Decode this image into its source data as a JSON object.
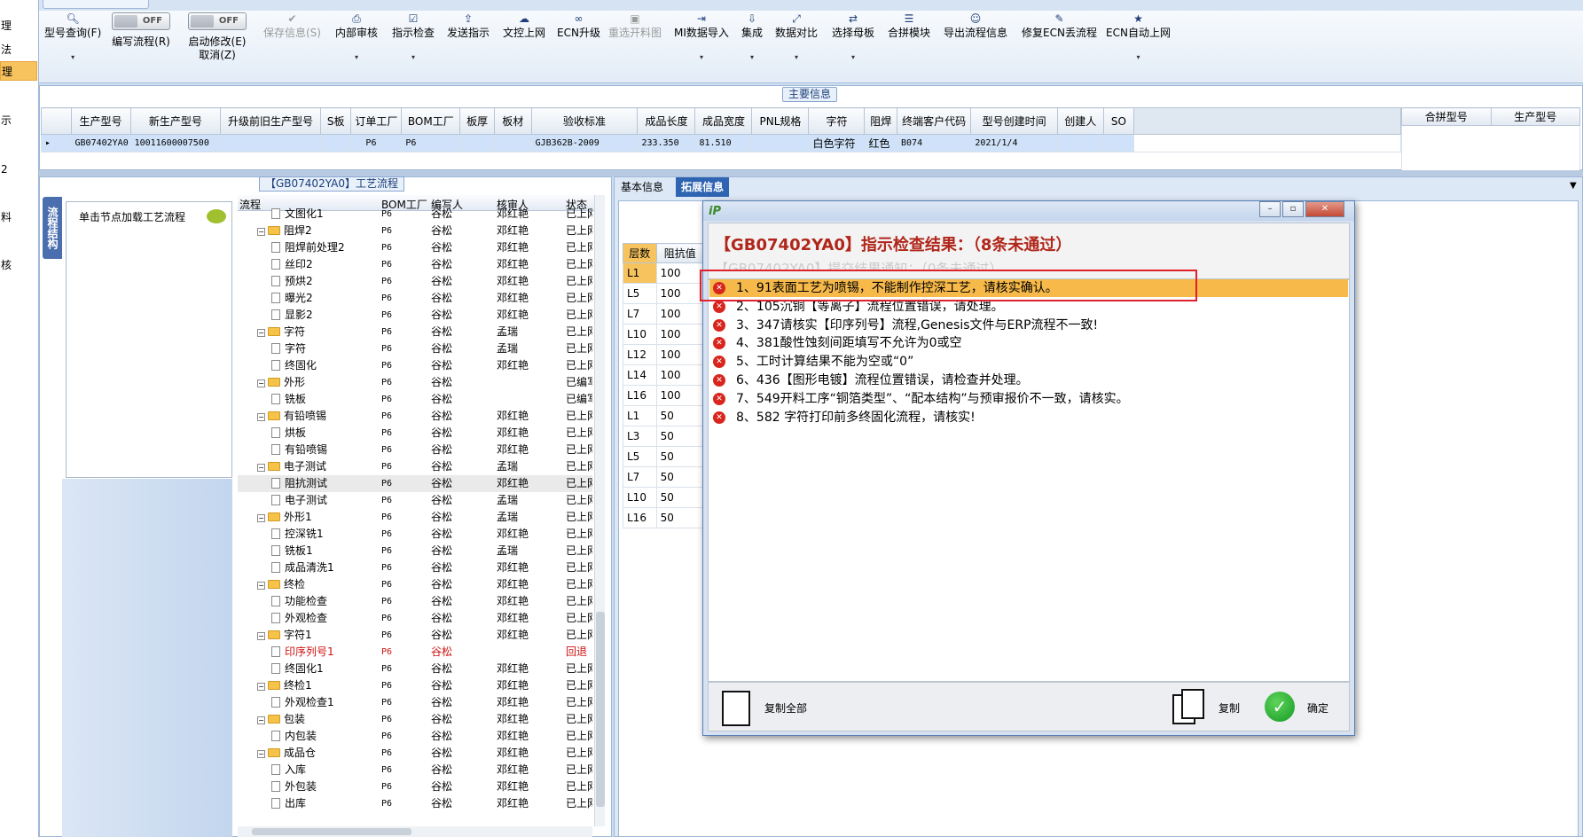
{
  "left_nav": {
    "items": [
      "理",
      "法",
      "理",
      "示",
      "2",
      "料",
      "核"
    ]
  },
  "toolbar": {
    "buttons": [
      {
        "label": "型号查询(F)",
        "icon": "search-icon",
        "dropdown": true
      },
      {
        "label": "编写流程(R)",
        "toggle": "OFF"
      },
      {
        "label": "启动修改(E)",
        "sub": "取消(Z)",
        "toggle": "OFF"
      },
      {
        "label": "保存信息(S)",
        "icon": "check-icon",
        "disabled": true
      },
      {
        "label": "内部审核",
        "icon": "printer-icon",
        "dropdown": true
      },
      {
        "label": "指示检查",
        "icon": "checklist-icon",
        "dropdown": true
      },
      {
        "label": "发送指示",
        "icon": "upload-icon"
      },
      {
        "label": "文控上网",
        "icon": "cloud-upload-icon"
      },
      {
        "label": "ECN升级",
        "icon": "binoculars-icon"
      },
      {
        "label": "重选开料图",
        "icon": "image-icon",
        "disabled": true
      },
      {
        "label": "MI数据导入",
        "icon": "import-icon",
        "dropdown": true
      },
      {
        "label": "集成",
        "icon": "download-icon",
        "dropdown": true
      },
      {
        "label": "数据对比",
        "icon": "compare-icon",
        "dropdown": true
      },
      {
        "label": "选择母板",
        "icon": "shuffle-icon",
        "dropdown": true
      },
      {
        "label": "合拼模块",
        "icon": "list-icon"
      },
      {
        "label": "导出流程信息",
        "icon": "smile-icon"
      },
      {
        "label": "修复ECN丢流程",
        "icon": "wrench-icon"
      },
      {
        "label": "ECN自动上网",
        "icon": "star-icon",
        "dropdown": true
      }
    ]
  },
  "main_info": {
    "section_label": "主要信息",
    "columns": [
      "生产型号",
      "新生产型号",
      "升级前旧生产型号",
      "S板",
      "订单工厂",
      "BOM工厂",
      "板厚",
      "板材",
      "验收标准",
      "成品长度",
      "成品宽度",
      "PNL规格",
      "字符",
      "阻焊",
      "终端客户代码",
      "型号创建时间",
      "创建人",
      "SO"
    ],
    "row": [
      "GB07402YA0",
      "10011600007500",
      "",
      "",
      "P6",
      "P6",
      "",
      "",
      "GJB362B-2009",
      "233.350",
      "81.510",
      "",
      "白色字符",
      "红色",
      "B074",
      "2021/1/4",
      "",
      ""
    ],
    "side_columns": [
      "合拼型号",
      "生产型号"
    ]
  },
  "process": {
    "section_label": "【GB07402YA0】工艺流程",
    "vertical_tab": "流程结构",
    "node_hint": "单击节点加载工艺流程",
    "headers": [
      "流程",
      "BOM工厂",
      "编写人",
      "核审人",
      "状态"
    ],
    "rows": [
      {
        "type": "leaf",
        "name": "文图化1",
        "bom": "P6",
        "writer": "谷松",
        "reviewer": "邓红艳",
        "status": "已上网"
      },
      {
        "type": "group",
        "name": "阻焊2",
        "bom": "P6",
        "writer": "谷松",
        "reviewer": "邓红艳",
        "status": "已上网"
      },
      {
        "type": "leaf",
        "name": "阻焊前处理2",
        "bom": "P6",
        "writer": "谷松",
        "reviewer": "邓红艳",
        "status": "已上网"
      },
      {
        "type": "leaf",
        "name": "丝印2",
        "bom": "P6",
        "writer": "谷松",
        "reviewer": "邓红艳",
        "status": "已上网"
      },
      {
        "type": "leaf",
        "name": "预烘2",
        "bom": "P6",
        "writer": "谷松",
        "reviewer": "邓红艳",
        "status": "已上网"
      },
      {
        "type": "leaf",
        "name": "曝光2",
        "bom": "P6",
        "writer": "谷松",
        "reviewer": "邓红艳",
        "status": "已上网"
      },
      {
        "type": "leaf",
        "name": "显影2",
        "bom": "P6",
        "writer": "谷松",
        "reviewer": "邓红艳",
        "status": "已上网"
      },
      {
        "type": "group",
        "name": "字符",
        "bom": "P6",
        "writer": "谷松",
        "reviewer": "孟瑞",
        "status": "已上网"
      },
      {
        "type": "leaf",
        "name": "字符",
        "bom": "P6",
        "writer": "谷松",
        "reviewer": "孟瑞",
        "status": "已上网"
      },
      {
        "type": "leaf",
        "name": "终固化",
        "bom": "P6",
        "writer": "谷松",
        "reviewer": "邓红艳",
        "status": "已上网"
      },
      {
        "type": "group",
        "name": "外形",
        "bom": "P6",
        "writer": "谷松",
        "reviewer": "",
        "status": "已编写"
      },
      {
        "type": "leaf",
        "name": "铣板",
        "bom": "P6",
        "writer": "谷松",
        "reviewer": "",
        "status": "已编写"
      },
      {
        "type": "group",
        "name": "有铅喷锡",
        "bom": "P6",
        "writer": "谷松",
        "reviewer": "邓红艳",
        "status": "已上网"
      },
      {
        "type": "leaf",
        "name": "烘板",
        "bom": "P6",
        "writer": "谷松",
        "reviewer": "邓红艳",
        "status": "已上网"
      },
      {
        "type": "leaf",
        "name": "有铅喷锡",
        "bom": "P6",
        "writer": "谷松",
        "reviewer": "邓红艳",
        "status": "已上网"
      },
      {
        "type": "group",
        "name": "电子测试",
        "bom": "P6",
        "writer": "谷松",
        "reviewer": "孟瑞",
        "status": "已上网"
      },
      {
        "type": "leaf",
        "name": "阻抗测试",
        "bom": "P6",
        "writer": "谷松",
        "reviewer": "邓红艳",
        "status": "已上网",
        "highlight": true
      },
      {
        "type": "leaf",
        "name": "电子测试",
        "bom": "P6",
        "writer": "谷松",
        "reviewer": "孟瑞",
        "status": "已上网"
      },
      {
        "type": "group",
        "name": "外形1",
        "bom": "P6",
        "writer": "谷松",
        "reviewer": "孟瑞",
        "status": "已上网"
      },
      {
        "type": "leaf",
        "name": "控深铣1",
        "bom": "P6",
        "writer": "谷松",
        "reviewer": "邓红艳",
        "status": "已上网"
      },
      {
        "type": "leaf",
        "name": "铣板1",
        "bom": "P6",
        "writer": "谷松",
        "reviewer": "孟瑞",
        "status": "已上网"
      },
      {
        "type": "leaf",
        "name": "成品清洗1",
        "bom": "P6",
        "writer": "谷松",
        "reviewer": "邓红艳",
        "status": "已上网"
      },
      {
        "type": "group",
        "name": "终检",
        "bom": "P6",
        "writer": "谷松",
        "reviewer": "邓红艳",
        "status": "已上网"
      },
      {
        "type": "leaf",
        "name": "功能检查",
        "bom": "P6",
        "writer": "谷松",
        "reviewer": "邓红艳",
        "status": "已上网"
      },
      {
        "type": "leaf",
        "name": "外观检查",
        "bom": "P6",
        "writer": "谷松",
        "reviewer": "邓红艳",
        "status": "已上网"
      },
      {
        "type": "group",
        "name": "字符1",
        "bom": "P6",
        "writer": "谷松",
        "reviewer": "邓红艳",
        "status": "已上网"
      },
      {
        "type": "leaf",
        "name": "印序列号1",
        "bom": "P6",
        "writer": "谷松",
        "reviewer": "",
        "status": "回退",
        "red": true
      },
      {
        "type": "leaf",
        "name": "终固化1",
        "bom": "P6",
        "writer": "谷松",
        "reviewer": "邓红艳",
        "status": "已上网"
      },
      {
        "type": "group",
        "name": "终检1",
        "bom": "P6",
        "writer": "谷松",
        "reviewer": "邓红艳",
        "status": "已上网"
      },
      {
        "type": "leaf",
        "name": "外观检查1",
        "bom": "P6",
        "writer": "谷松",
        "reviewer": "邓红艳",
        "status": "已上网"
      },
      {
        "type": "group",
        "name": "包装",
        "bom": "P6",
        "writer": "谷松",
        "reviewer": "邓红艳",
        "status": "已上网"
      },
      {
        "type": "leaf",
        "name": "内包装",
        "bom": "P6",
        "writer": "谷松",
        "reviewer": "邓红艳",
        "status": "已上网"
      },
      {
        "type": "group",
        "name": "成品仓",
        "bom": "P6",
        "writer": "谷松",
        "reviewer": "邓红艳",
        "status": "已上网"
      },
      {
        "type": "leaf",
        "name": "入库",
        "bom": "P6",
        "writer": "谷松",
        "reviewer": "邓红艳",
        "status": "已上网"
      },
      {
        "type": "leaf",
        "name": "外包装",
        "bom": "P6",
        "writer": "谷松",
        "reviewer": "邓红艳",
        "status": "已上网"
      },
      {
        "type": "leaf",
        "name": "出库",
        "bom": "P6",
        "writer": "谷松",
        "reviewer": "邓红艳",
        "status": "已上网"
      }
    ]
  },
  "right_panel": {
    "tabs": [
      "基本信息",
      "拓展信息"
    ],
    "active_tab": "拓展信息",
    "layer_headers": [
      "层数",
      "阻抗值"
    ],
    "layer_rows": [
      [
        "L1",
        "100"
      ],
      [
        "L5",
        "100"
      ],
      [
        "L7",
        "100"
      ],
      [
        "L10",
        "100"
      ],
      [
        "L12",
        "100"
      ],
      [
        "L14",
        "100"
      ],
      [
        "L16",
        "100"
      ],
      [
        "L1",
        "50"
      ],
      [
        "L3",
        "50"
      ],
      [
        "L5",
        "50"
      ],
      [
        "L7",
        "50"
      ],
      [
        "L10",
        "50"
      ],
      [
        "L16",
        "50"
      ]
    ]
  },
  "dialog": {
    "title": "【GB07402YA0】指示检查结果：（8条未通过）",
    "subtitle": "【GB07402YA0】提交结果通知：（0条未通过）",
    "items": [
      "1、91表面工艺为喷锡，不能制作控深工艺，请核实确认。",
      "2、105沉铜【等离子】流程位置错误，请处理。",
      "3、347请核实【印序列号】流程,Genesis文件与ERP流程不一致!",
      "4、381酸性蚀刻间距填写不允许为0或空",
      "5、工时计算结果不能为空或“0”",
      "6、436【图形电镀】流程位置错误，请检查并处理。",
      "7、549开料工序“铜箔类型”、“配本结构”与预审报价不一致，请核实。",
      "8、582 字符打印前多终固化流程，请核实!"
    ],
    "copy_all": "复制全部",
    "copy": "复制",
    "ok": "确定"
  },
  "colors": {
    "accent": "#2f64b3",
    "selected_item": "#f6b94a",
    "error": "#d8261e",
    "title_red": "#b1261a"
  }
}
